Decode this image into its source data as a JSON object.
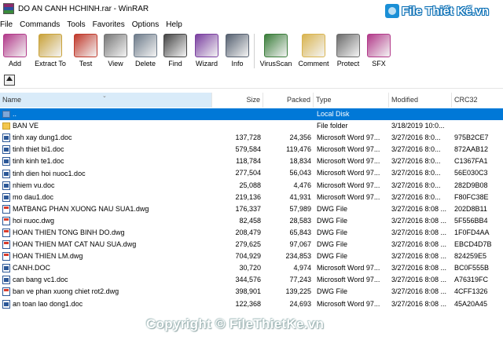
{
  "window": {
    "title": "DO AN CANH HCHINH.rar - WinRAR"
  },
  "watermark": {
    "logo_text": "File Thiết Kế.vn",
    "copyright": "Copyright © FileThietKe.vn"
  },
  "menu": [
    "File",
    "Commands",
    "Tools",
    "Favorites",
    "Options",
    "Help"
  ],
  "toolbar": [
    {
      "label": "Add",
      "icon": "add-books-icon",
      "color": "#b23a8a"
    },
    {
      "label": "Extract To",
      "icon": "extract-folder-icon",
      "color": "#c9a23a"
    },
    {
      "label": "Test",
      "icon": "test-checkbox-icon",
      "color": "#c0392b"
    },
    {
      "label": "View",
      "icon": "view-glasses-icon",
      "color": "#777777"
    },
    {
      "label": "Delete",
      "icon": "delete-trash-icon",
      "color": "#6d7b8a"
    },
    {
      "label": "Find",
      "icon": "find-binoculars-icon",
      "color": "#444444"
    },
    {
      "label": "Wizard",
      "icon": "wizard-icon",
      "color": "#7a3fa0"
    },
    {
      "label": "Info",
      "icon": "info-icon",
      "color": "#556070"
    },
    {
      "label": "VirusScan",
      "icon": "virus-scan-icon",
      "color": "#3a7d3a"
    },
    {
      "label": "Comment",
      "icon": "comment-icon",
      "color": "#d9b450"
    },
    {
      "label": "Protect",
      "icon": "protect-shield-icon",
      "color": "#6b6b6b"
    },
    {
      "label": "SFX",
      "icon": "sfx-books-icon",
      "color": "#b23a8a"
    }
  ],
  "columns": [
    "Name",
    "Size",
    "Packed",
    "Type",
    "Modified",
    "CRC32"
  ],
  "files": [
    {
      "name": "..",
      "size": "",
      "packed": "",
      "type": "Local Disk",
      "modified": "",
      "crc": "",
      "kind": "up",
      "selected": true
    },
    {
      "name": "BAN VE",
      "size": "",
      "packed": "",
      "type": "File folder",
      "modified": "3/18/2019 10:0...",
      "crc": "",
      "kind": "folder"
    },
    {
      "name": "tinh xay dung1.doc",
      "size": "137,728",
      "packed": "24,356",
      "type": "Microsoft Word 97...",
      "modified": "3/27/2016 8:0...",
      "crc": "975B2CE7",
      "kind": "doc"
    },
    {
      "name": "tinh thiet bi1.doc",
      "size": "579,584",
      "packed": "119,476",
      "type": "Microsoft Word 97...",
      "modified": "3/27/2016 8:0...",
      "crc": "872AAB12",
      "kind": "doc"
    },
    {
      "name": "tinh kinh te1.doc",
      "size": "118,784",
      "packed": "18,834",
      "type": "Microsoft Word 97...",
      "modified": "3/27/2016 8:0...",
      "crc": "C1367FA1",
      "kind": "doc"
    },
    {
      "name": "tinh dien hoi nuoc1.doc",
      "size": "277,504",
      "packed": "56,043",
      "type": "Microsoft Word 97...",
      "modified": "3/27/2016 8:0...",
      "crc": "56E030C3",
      "kind": "doc"
    },
    {
      "name": "nhiem vu.doc",
      "size": "25,088",
      "packed": "4,476",
      "type": "Microsoft Word 97...",
      "modified": "3/27/2016 8:0...",
      "crc": "282D9B08",
      "kind": "doc"
    },
    {
      "name": "mo dau1.doc",
      "size": "219,136",
      "packed": "41,931",
      "type": "Microsoft Word 97...",
      "modified": "3/27/2016 8:0...",
      "crc": "F80FC38E",
      "kind": "doc"
    },
    {
      "name": "MATBANG PHAN XUONG NAU SUA1.dwg",
      "size": "176,337",
      "packed": "57,989",
      "type": "DWG File",
      "modified": "3/27/2016 8:08 ...",
      "crc": "202D8B11",
      "kind": "dwg"
    },
    {
      "name": "hoi nuoc.dwg",
      "size": "82,458",
      "packed": "28,583",
      "type": "DWG File",
      "modified": "3/27/2016 8:08 ...",
      "crc": "5F556BB4",
      "kind": "dwg"
    },
    {
      "name": "HOAN THIEN TONG BINH DO.dwg",
      "size": "208,479",
      "packed": "65,843",
      "type": "DWG File",
      "modified": "3/27/2016 8:08 ...",
      "crc": "1F0FD4AA",
      "kind": "dwg"
    },
    {
      "name": "HOAN THIEN MAT CAT NAU SUA.dwg",
      "size": "279,625",
      "packed": "97,067",
      "type": "DWG File",
      "modified": "3/27/2016 8:08 ...",
      "crc": "EBCD4D7B",
      "kind": "dwg"
    },
    {
      "name": "HOAN THIEN LM.dwg",
      "size": "704,929",
      "packed": "234,853",
      "type": "DWG File",
      "modified": "3/27/2016 8:08 ...",
      "crc": "824259E5",
      "kind": "dwg"
    },
    {
      "name": "CANH.DOC",
      "size": "30,720",
      "packed": "4,974",
      "type": "Microsoft Word 97...",
      "modified": "3/27/2016 8:08 ...",
      "crc": "BC0F555B",
      "kind": "doc"
    },
    {
      "name": "can bang vc1.doc",
      "size": "344,576",
      "packed": "77,243",
      "type": "Microsoft Word 97...",
      "modified": "3/27/2016 8:08 ...",
      "crc": "A76319FC",
      "kind": "doc"
    },
    {
      "name": "ban ve phan xuong chiet rot2.dwg",
      "size": "398,901",
      "packed": "139,225",
      "type": "DWG File",
      "modified": "3/27/2016 8:08 ...",
      "crc": "4CFF1326",
      "kind": "dwg"
    },
    {
      "name": "an toan lao dong1.doc",
      "size": "122,368",
      "packed": "24,693",
      "type": "Microsoft Word 97...",
      "modified": "3/27/2016 8:08 ...",
      "crc": "45A20A45",
      "kind": "doc"
    }
  ]
}
